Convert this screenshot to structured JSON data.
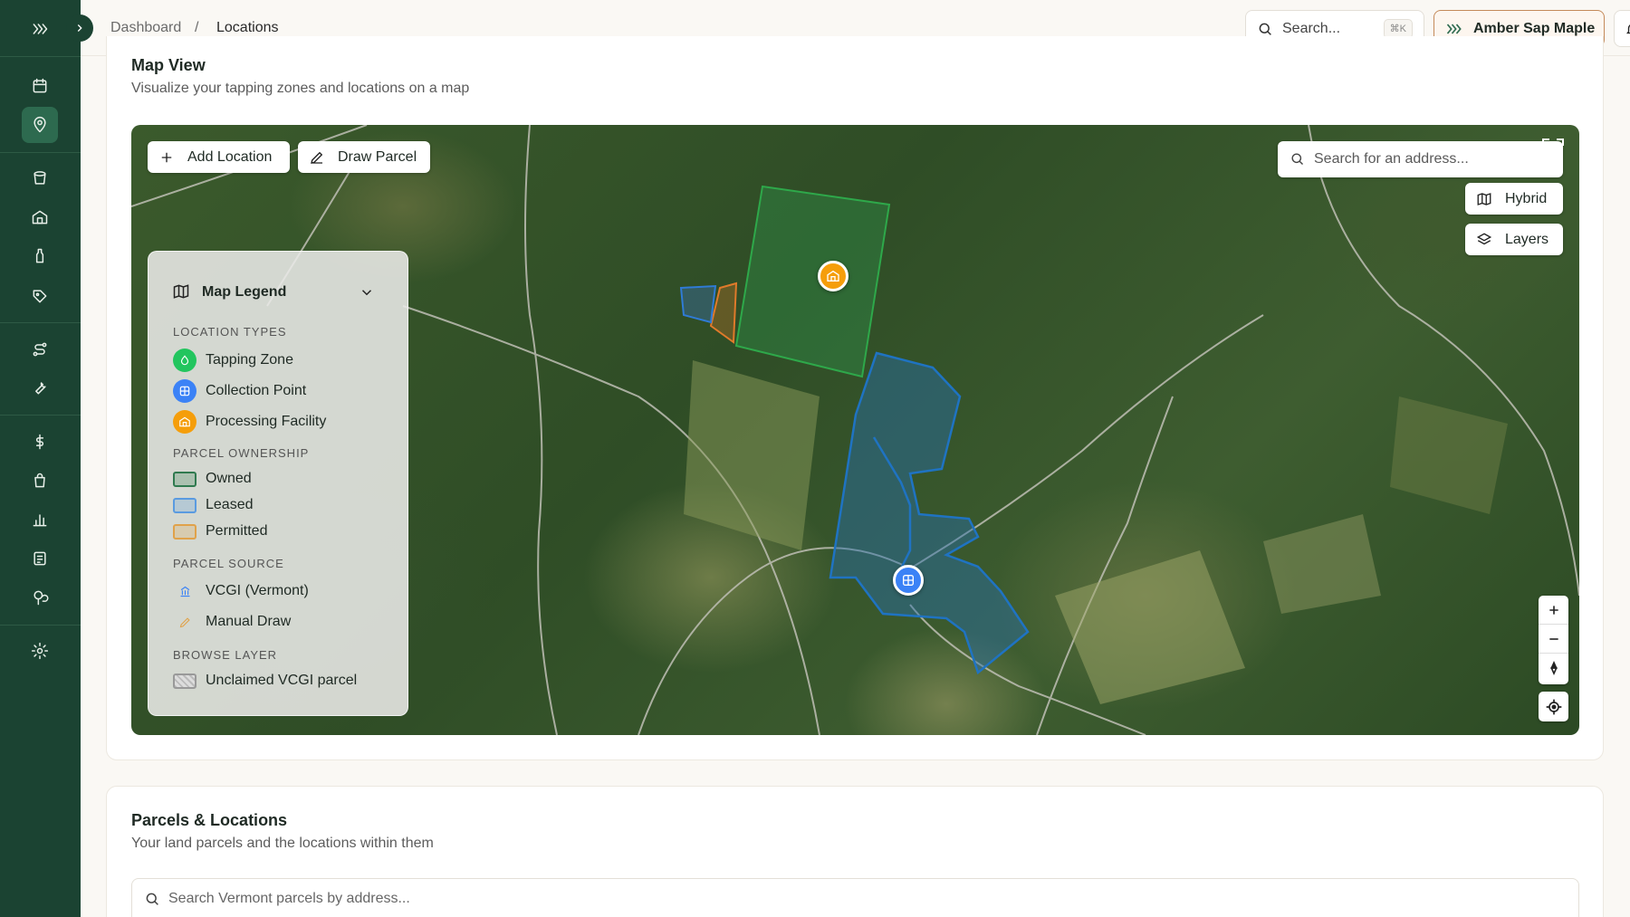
{
  "sidebar": {
    "items": [
      {
        "icon": "chevrons-right-icon"
      },
      {
        "icon": "calendar-icon"
      },
      {
        "icon": "map-pin-icon",
        "active": true
      },
      {
        "icon": "bucket-icon"
      },
      {
        "icon": "sugarhouse-icon"
      },
      {
        "icon": "bottle-icon"
      },
      {
        "icon": "tag-icon"
      },
      {
        "icon": "route-icon"
      },
      {
        "icon": "wrench-icon"
      },
      {
        "icon": "dollar-icon"
      },
      {
        "icon": "shopping-bag-icon"
      },
      {
        "icon": "bar-chart-icon"
      },
      {
        "icon": "report-icon"
      },
      {
        "icon": "tree-icon"
      },
      {
        "icon": "settings-icon"
      }
    ],
    "toggle_icon": "chevron-right-icon"
  },
  "topbar": {
    "breadcrumb": [
      "Dashboard",
      "/",
      "Locations"
    ],
    "search_label": "Search...",
    "search_shortcut": "⌘K",
    "org_name": "Amber Sap Maple",
    "bell_icon": "bell-icon",
    "theme_icon": "theme-toggle-icon"
  },
  "map_card": {
    "title": "Map View",
    "subtitle": "Visualize your tapping zones and locations on a map",
    "add_location": "Add Location",
    "draw_parcel": "Draw Parcel",
    "address_placeholder": "Search for an address...",
    "hybrid": "Hybrid",
    "layers": "Layers",
    "legend": {
      "title": "Map Legend",
      "location_types_title": "Location Types",
      "location_types": [
        {
          "label": "Tapping Zone",
          "color": "#22c55e"
        },
        {
          "label": "Collection Point",
          "color": "#3b82f6"
        },
        {
          "label": "Processing Facility",
          "color": "#f59e0b"
        }
      ],
      "ownership_title": "Parcel Ownership",
      "ownership": [
        {
          "label": "Owned",
          "color": "#2f7a4f"
        },
        {
          "label": "Leased",
          "color": "#5a9be0"
        },
        {
          "label": "Permitted",
          "color": "#e0a24a"
        }
      ],
      "source_title": "Parcel Source",
      "sources": [
        {
          "label": "VCGI (Vermont)",
          "icon": "building-icon"
        },
        {
          "label": "Manual Draw",
          "icon": "pencil-icon"
        }
      ],
      "browse_title": "Browse Layer",
      "browse": [
        {
          "label": "Unclaimed VCGI parcel"
        }
      ]
    }
  },
  "parcels_card": {
    "title": "Parcels & Locations",
    "subtitle": "Your land parcels and the locations within them",
    "search_placeholder": "Search Vermont parcels by address..."
  }
}
